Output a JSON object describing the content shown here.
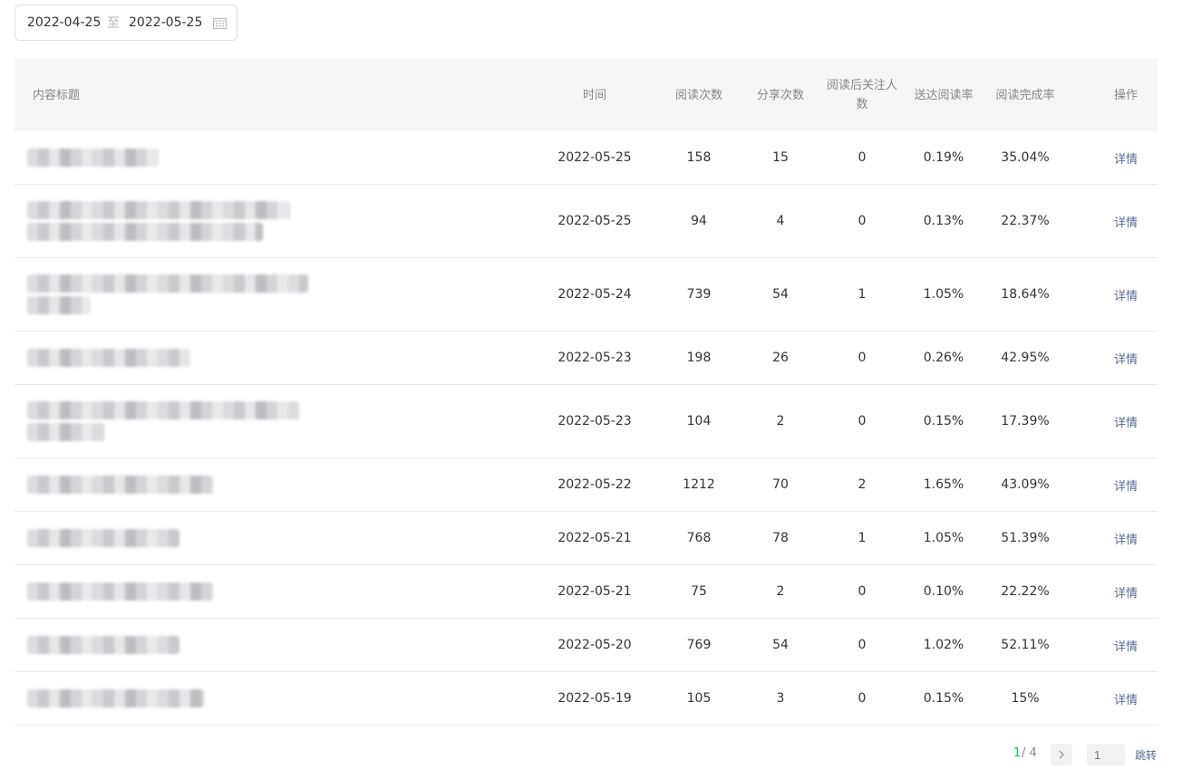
{
  "date_range": {
    "start": "2022-04-25",
    "separator": "至",
    "end": "2022-05-25"
  },
  "table": {
    "headers": {
      "title": "内容标题",
      "time": "时间",
      "reads": "阅读次数",
      "shares": "分享次数",
      "follows": "阅读后关注人数",
      "reach_rate": "送达阅读率",
      "completion_rate": "阅读完成率",
      "action": "操作"
    },
    "rows": [
      {
        "time": "2022-05-25",
        "reads": "158",
        "shares": "15",
        "follows": "0",
        "reach_rate": "0.19%",
        "completion_rate": "35.04%",
        "action": "详情"
      },
      {
        "time": "2022-05-25",
        "reads": "94",
        "shares": "4",
        "follows": "0",
        "reach_rate": "0.13%",
        "completion_rate": "22.37%",
        "action": "详情"
      },
      {
        "time": "2022-05-24",
        "reads": "739",
        "shares": "54",
        "follows": "1",
        "reach_rate": "1.05%",
        "completion_rate": "18.64%",
        "action": "详情"
      },
      {
        "time": "2022-05-23",
        "reads": "198",
        "shares": "26",
        "follows": "0",
        "reach_rate": "0.26%",
        "completion_rate": "42.95%",
        "action": "详情"
      },
      {
        "time": "2022-05-23",
        "reads": "104",
        "shares": "2",
        "follows": "0",
        "reach_rate": "0.15%",
        "completion_rate": "17.39%",
        "action": "详情"
      },
      {
        "time": "2022-05-22",
        "reads": "1212",
        "shares": "70",
        "follows": "2",
        "reach_rate": "1.65%",
        "completion_rate": "43.09%",
        "action": "详情"
      },
      {
        "time": "2022-05-21",
        "reads": "768",
        "shares": "78",
        "follows": "1",
        "reach_rate": "1.05%",
        "completion_rate": "51.39%",
        "action": "详情"
      },
      {
        "time": "2022-05-21",
        "reads": "75",
        "shares": "2",
        "follows": "0",
        "reach_rate": "0.10%",
        "completion_rate": "22.22%",
        "action": "详情"
      },
      {
        "time": "2022-05-20",
        "reads": "769",
        "shares": "54",
        "follows": "0",
        "reach_rate": "1.02%",
        "completion_rate": "52.11%",
        "action": "详情"
      },
      {
        "time": "2022-05-19",
        "reads": "105",
        "shares": "3",
        "follows": "0",
        "reach_rate": "0.15%",
        "completion_rate": "15%",
        "action": "详情"
      }
    ]
  },
  "pagination": {
    "current": "1",
    "total_text": " / 4",
    "next_icon": "chevron-right-icon",
    "input_placeholder": "1",
    "jump_label": "跳转"
  },
  "icons": {
    "calendar": "calendar-icon"
  }
}
